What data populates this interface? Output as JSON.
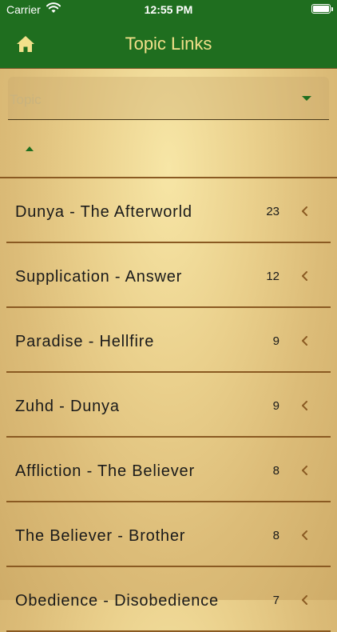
{
  "status_bar": {
    "carrier": "Carrier",
    "time": "12:55 PM"
  },
  "nav": {
    "title": "Topic Links",
    "home_icon": "home-icon"
  },
  "picker": {
    "placeholder": "Topic",
    "icon": "chevron-down-icon"
  },
  "colors": {
    "nav_green": "#1f6e1f",
    "title_gold": "#f2e08a",
    "divider_brown": "#8a5a22",
    "chevron_brown": "#8a5a22"
  },
  "topics": [
    {
      "label": "Dunya - The Afterworld",
      "count": "23"
    },
    {
      "label": "Supplication - Answer",
      "count": "12"
    },
    {
      "label": "Paradise - Hellfire",
      "count": "9"
    },
    {
      "label": "Zuhd - Dunya",
      "count": "9"
    },
    {
      "label": "Affliction - The Believer",
      "count": "8"
    },
    {
      "label": "The Believer - Brother",
      "count": "8"
    },
    {
      "label": "Obedience - Disobedience",
      "count": "7"
    }
  ]
}
